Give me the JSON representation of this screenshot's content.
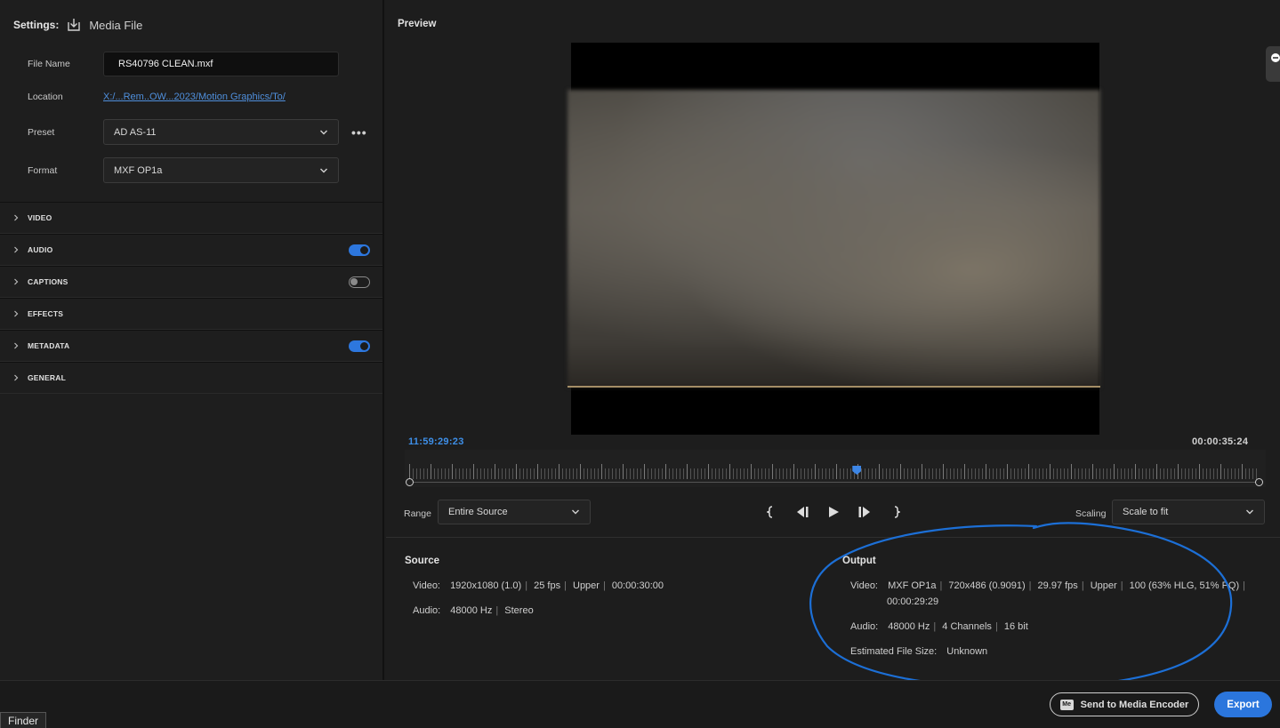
{
  "settings": {
    "title": "Settings:",
    "media_label": "Media File",
    "file_name_label": "File Name",
    "file_name_value": "RS40796 CLEAN.mxf",
    "location_label": "Location",
    "location_value": "X:/...Rem..OW...2023/Motion Graphics/To/",
    "preset_label": "Preset",
    "preset_value": "AD AS-11",
    "format_label": "Format",
    "format_value": "MXF OP1a",
    "sections": [
      {
        "label": "VIDEO",
        "toggle": null
      },
      {
        "label": "AUDIO",
        "toggle": "on"
      },
      {
        "label": "CAPTIONS",
        "toggle": "off"
      },
      {
        "label": "EFFECTS",
        "toggle": null
      },
      {
        "label": "METADATA",
        "toggle": "on"
      },
      {
        "label": "GENERAL",
        "toggle": null
      }
    ]
  },
  "preview": {
    "title": "Preview",
    "timecode_current": "11:59:29:23",
    "timecode_duration": "00:00:35:24",
    "playhead_fraction": 0.527,
    "range_label": "Range",
    "range_value": "Entire Source",
    "scaling_label": "Scaling",
    "scaling_value": "Scale to fit"
  },
  "source": {
    "title": "Source",
    "video_label": "Video:",
    "video_value": "1920x1080 (1.0)",
    "video_fps": "25 fps",
    "video_field": "Upper",
    "video_duration": "00:00:30:00",
    "audio_label": "Audio:",
    "audio_rate": "48000 Hz",
    "audio_channels": "Stereo"
  },
  "output": {
    "title": "Output",
    "video_label": "Video:",
    "video_format": "MXF OP1a",
    "video_res": "720x486 (0.9091)",
    "video_fps": "29.97 fps",
    "video_field": "Upper",
    "video_quality": "100 (63% HLG, 51% PQ)",
    "video_duration": "00:00:29:29",
    "audio_label": "Audio:",
    "audio_rate": "48000 Hz",
    "audio_channels": "4 Channels",
    "audio_bits": "16 bit",
    "size_label": "Estimated File Size:",
    "size_value": "Unknown"
  },
  "footer": {
    "send_encoder_label": "Send to Media Encoder",
    "encoder_badge": "Me",
    "export_label": "Export",
    "finder_label": "Finder"
  },
  "colors": {
    "accent": "#2b76dd",
    "timecode": "#3e8fe8",
    "annotation": "#1c6fd6"
  }
}
